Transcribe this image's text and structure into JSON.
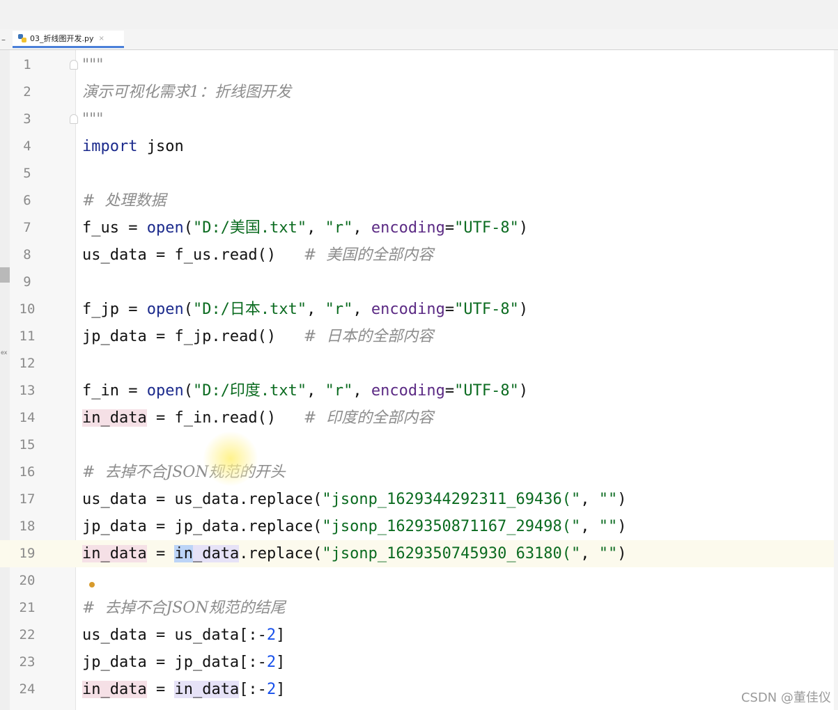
{
  "tab": {
    "filename": "03_折线图开发.py",
    "close_glyph": "×"
  },
  "left_marker_text": "ex",
  "current_line": 19,
  "lines": [
    {
      "n": "1"
    },
    {
      "n": "2"
    },
    {
      "n": "3"
    },
    {
      "n": "4"
    },
    {
      "n": "5"
    },
    {
      "n": "6"
    },
    {
      "n": "7"
    },
    {
      "n": "8"
    },
    {
      "n": "9"
    },
    {
      "n": "10"
    },
    {
      "n": "11"
    },
    {
      "n": "12"
    },
    {
      "n": "13"
    },
    {
      "n": "14"
    },
    {
      "n": "15"
    },
    {
      "n": "16"
    },
    {
      "n": "17"
    },
    {
      "n": "18"
    },
    {
      "n": "19"
    },
    {
      "n": "20"
    },
    {
      "n": "21"
    },
    {
      "n": "22"
    },
    {
      "n": "23"
    },
    {
      "n": "24"
    }
  ],
  "code": {
    "l1": "\"\"\"",
    "l2": "演示可视化需求1：折线图开发",
    "l3": "\"\"\"",
    "l4_kw": "import",
    "l4_rest": " json",
    "l6": "#  处理数据",
    "l7_a": "f_us = ",
    "l7_fn": "open",
    "l7_b": "(",
    "l7_s1": "\"D:/美国.txt\"",
    "l7_c": ", ",
    "l7_s2": "\"r\"",
    "l7_d": ", ",
    "l7_kw": "encoding",
    "l7_e": "=",
    "l7_s3": "\"UTF-8\"",
    "l7_f": ")",
    "l8_code": "us_data = f_us.read()   ",
    "l8_cmt": "#  美国的全部内容",
    "l10_a": "f_jp = ",
    "l10_fn": "open",
    "l10_b": "(",
    "l10_s1": "\"D:/日本.txt\"",
    "l10_c": ", ",
    "l10_s2": "\"r\"",
    "l10_d": ", ",
    "l10_kw": "encoding",
    "l10_e": "=",
    "l10_s3": "\"UTF-8\"",
    "l10_f": ")",
    "l11_code": "jp_data = f_jp.read()   ",
    "l11_cmt": "#  日本的全部内容",
    "l13_a": "f_in = ",
    "l13_fn": "open",
    "l13_b": "(",
    "l13_s1": "\"D:/印度.txt\"",
    "l13_c": ", ",
    "l13_s2": "\"r\"",
    "l13_d": ", ",
    "l13_kw": "encoding",
    "l13_e": "=",
    "l13_s3": "\"UTF-8\"",
    "l13_f": ")",
    "l14_var": "in_data",
    "l14_code": " = f_in.read()   ",
    "l14_cmt": "#  印度的全部内容",
    "l16": "#  去掉不合JSON规范的开头",
    "l17_a": "us_data = us_data.replace(",
    "l17_s1": "\"jsonp_1629344292311_69436(\"",
    "l17_b": ", ",
    "l17_s2": "\"\"",
    "l17_c": ")",
    "l18_a": "jp_data = jp_data.replace(",
    "l18_s1": "\"jsonp_1629350871167_29498(\"",
    "l18_b": ", ",
    "l18_s2": "\"\"",
    "l18_c": ")",
    "l19_var": "in_data",
    "l19_a": " = ",
    "l19_sel": "in",
    "l19_var2": "_data",
    "l19_b": ".replace(",
    "l19_s1": "\"jsonp_1629350745930_63180(\"",
    "l19_c": ", ",
    "l19_s2": "\"\"",
    "l19_d": ")",
    "l21": "#  去掉不合JSON规范的结尾",
    "l22_a": "us_data = us_data[:-",
    "l22_num": "2",
    "l22_b": "]",
    "l23_a": "jp_data = jp_data[:-",
    "l23_num": "2",
    "l23_b": "]",
    "l24_var": "in_data",
    "l24_a": " = ",
    "l24_var2": "in_data",
    "l24_b": "[:-",
    "l24_num": "2",
    "l24_c": "]"
  },
  "watermark": "CSDN @董佳仪"
}
